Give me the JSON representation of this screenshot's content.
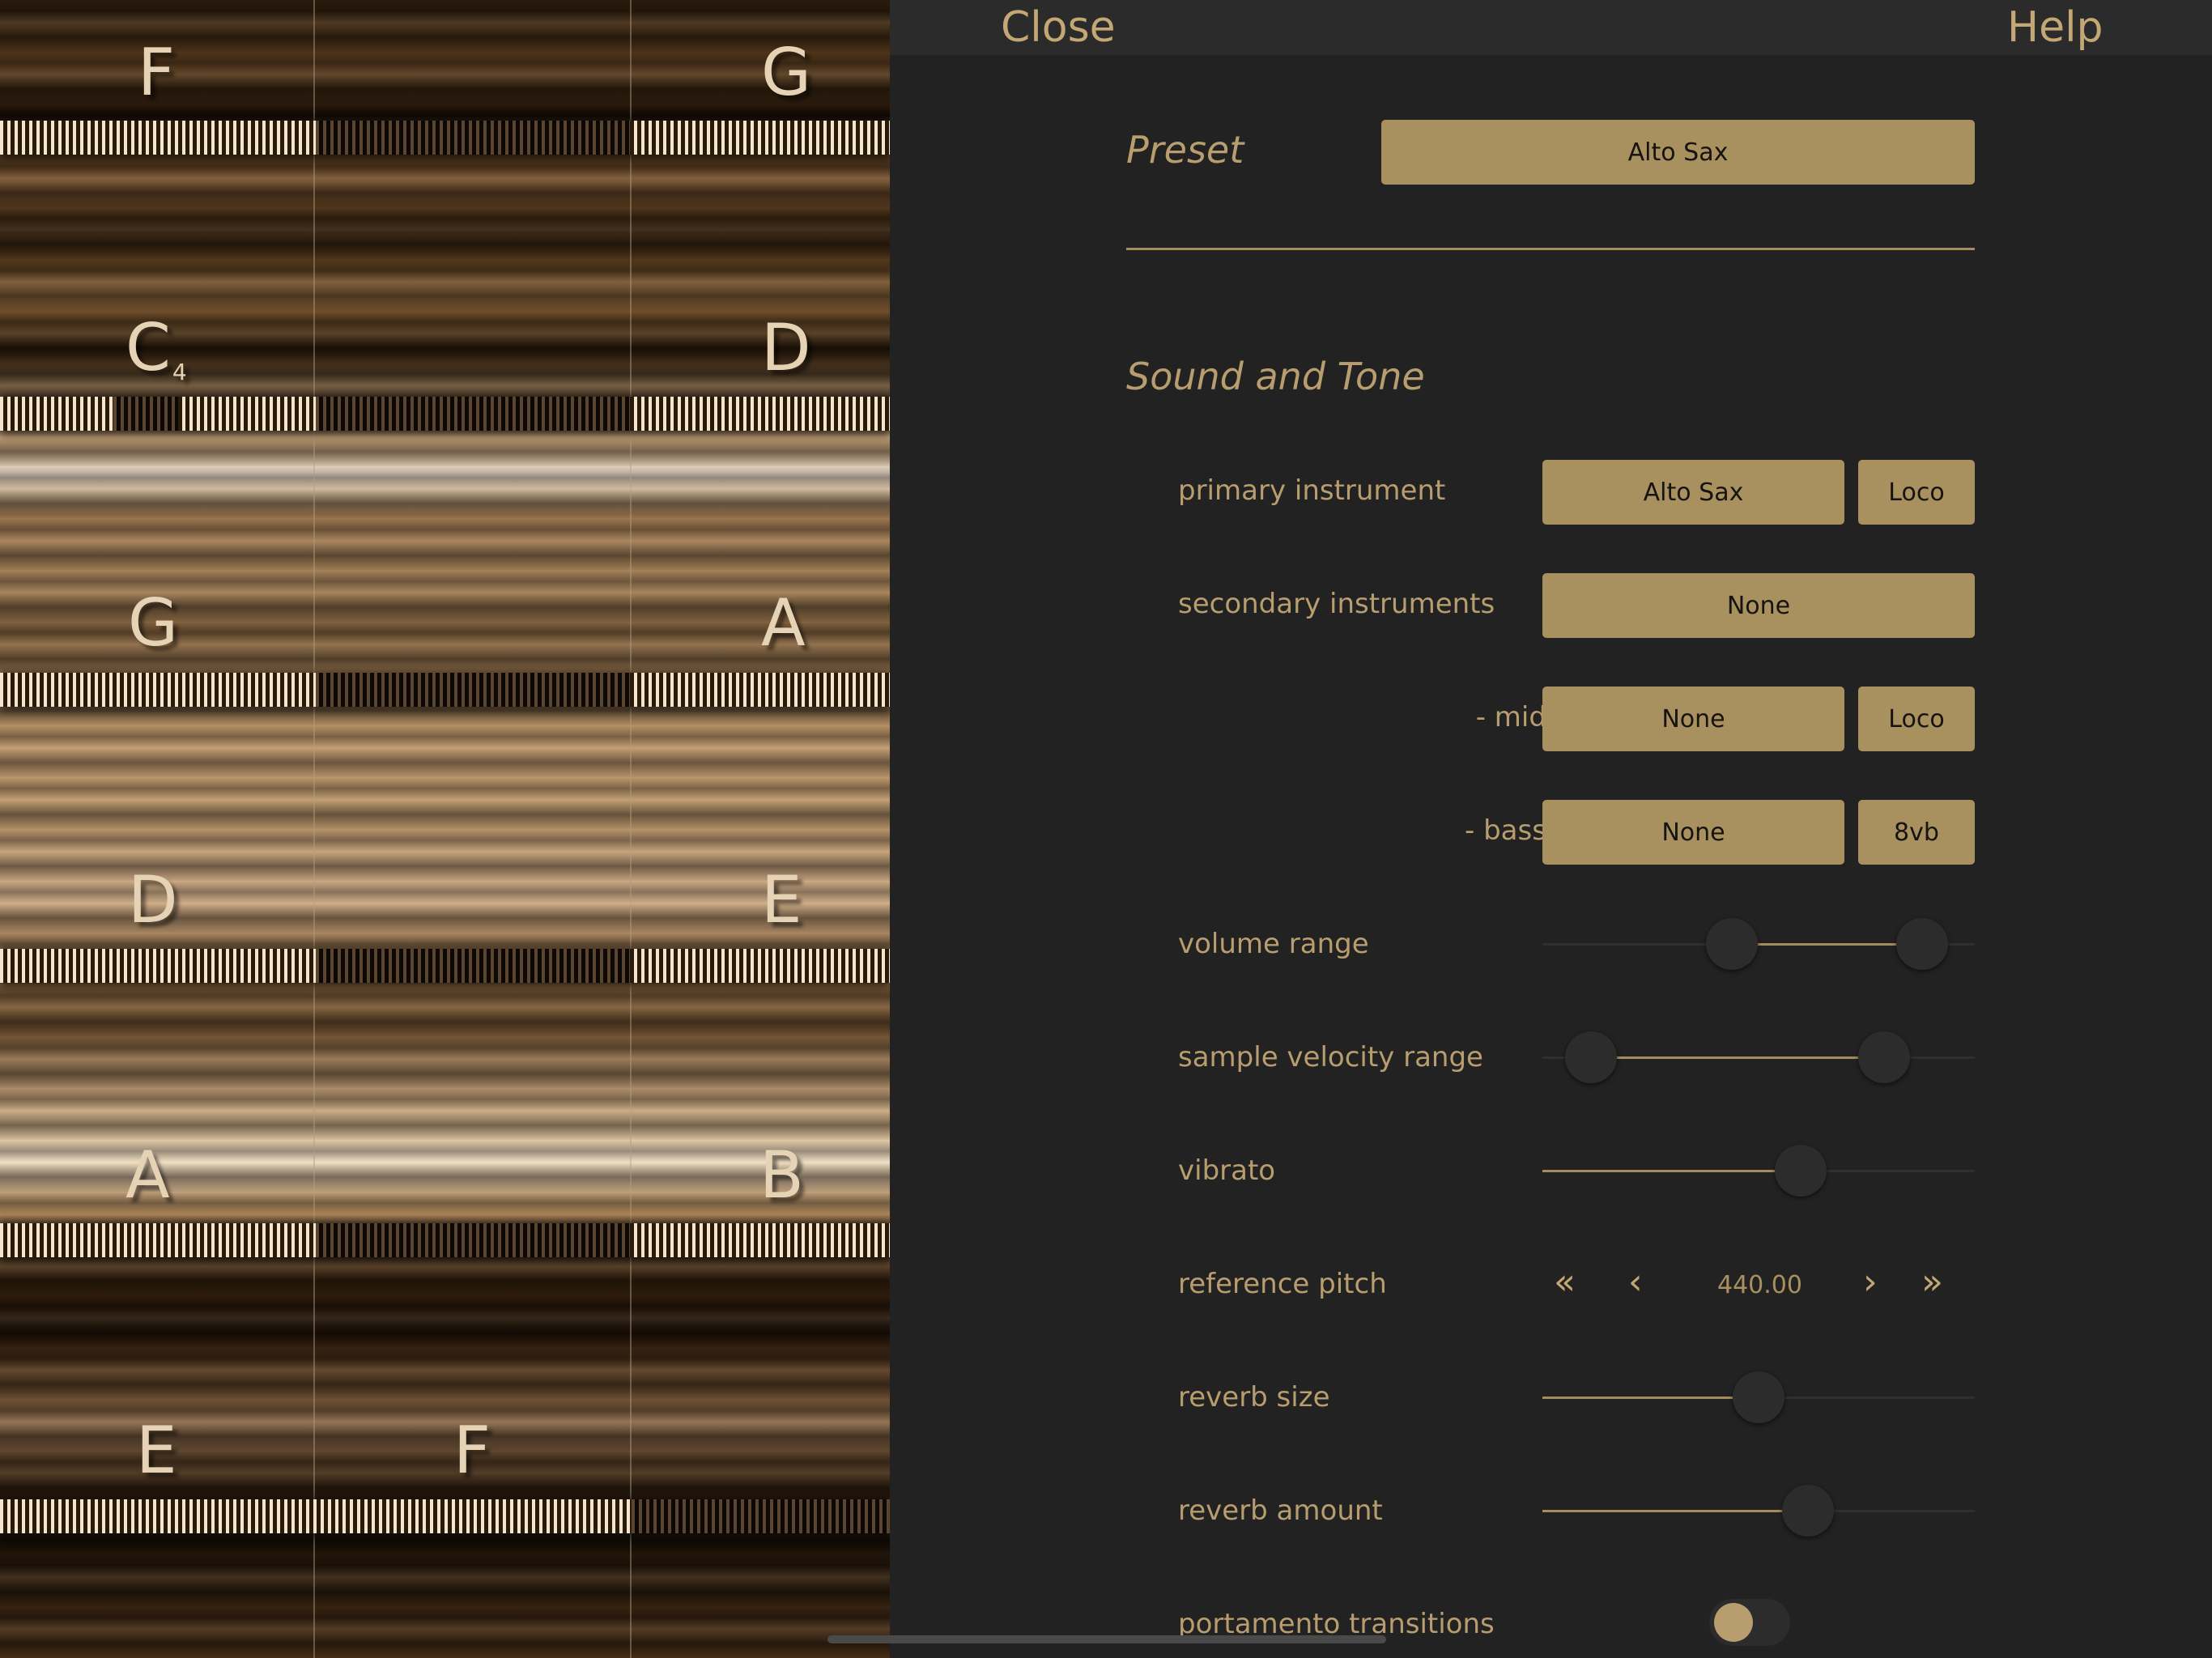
{
  "topbar": {
    "close_label": "Close",
    "help_label": "Help"
  },
  "keyboard": {
    "notes": [
      {
        "label": "F",
        "sub": ""
      },
      {
        "label": "G",
        "sub": ""
      },
      {
        "label": "C",
        "sub": "4"
      },
      {
        "label": "D",
        "sub": ""
      },
      {
        "label": "G",
        "sub": ""
      },
      {
        "label": "A",
        "sub": ""
      },
      {
        "label": "D",
        "sub": ""
      },
      {
        "label": "E",
        "sub": ""
      },
      {
        "label": "A",
        "sub": ""
      },
      {
        "label": "B",
        "sub": ""
      },
      {
        "label": "E",
        "sub": ""
      },
      {
        "label": "F",
        "sub": ""
      }
    ]
  },
  "preset": {
    "title": "Preset",
    "value": "Alto Sax"
  },
  "sound": {
    "title": "Sound and Tone",
    "primary": {
      "label": "primary instrument",
      "value": "Alto Sax",
      "articulation": "Loco"
    },
    "secondary": {
      "label": "secondary instruments",
      "value": "None"
    },
    "mid": {
      "label": "- mid -",
      "value": "None",
      "articulation": "Loco"
    },
    "bass": {
      "label": "- bass -",
      "value": "None",
      "articulation": "8vb"
    },
    "volume_range": {
      "label": "volume range",
      "low": 0.43,
      "high": 0.93
    },
    "velocity_range": {
      "label": "sample velocity range",
      "low": 0.06,
      "high": 0.83
    },
    "vibrato": {
      "label": "vibrato",
      "value": 0.61
    },
    "reference_pitch": {
      "label": "reference pitch",
      "value": "440.00"
    },
    "reverb_size": {
      "label": "reverb size",
      "value": 0.5
    },
    "reverb_amount": {
      "label": "reverb amount",
      "value": 0.63
    },
    "portamento": {
      "label": "portamento transitions",
      "on": false
    }
  },
  "colors": {
    "accent": "#a8905f",
    "text_gold": "#b89d6e",
    "panel_bg": "#222222"
  },
  "icons": {
    "pitch_fast_down": "«",
    "pitch_down": "‹",
    "pitch_up": "›",
    "pitch_fast_up": "»"
  }
}
